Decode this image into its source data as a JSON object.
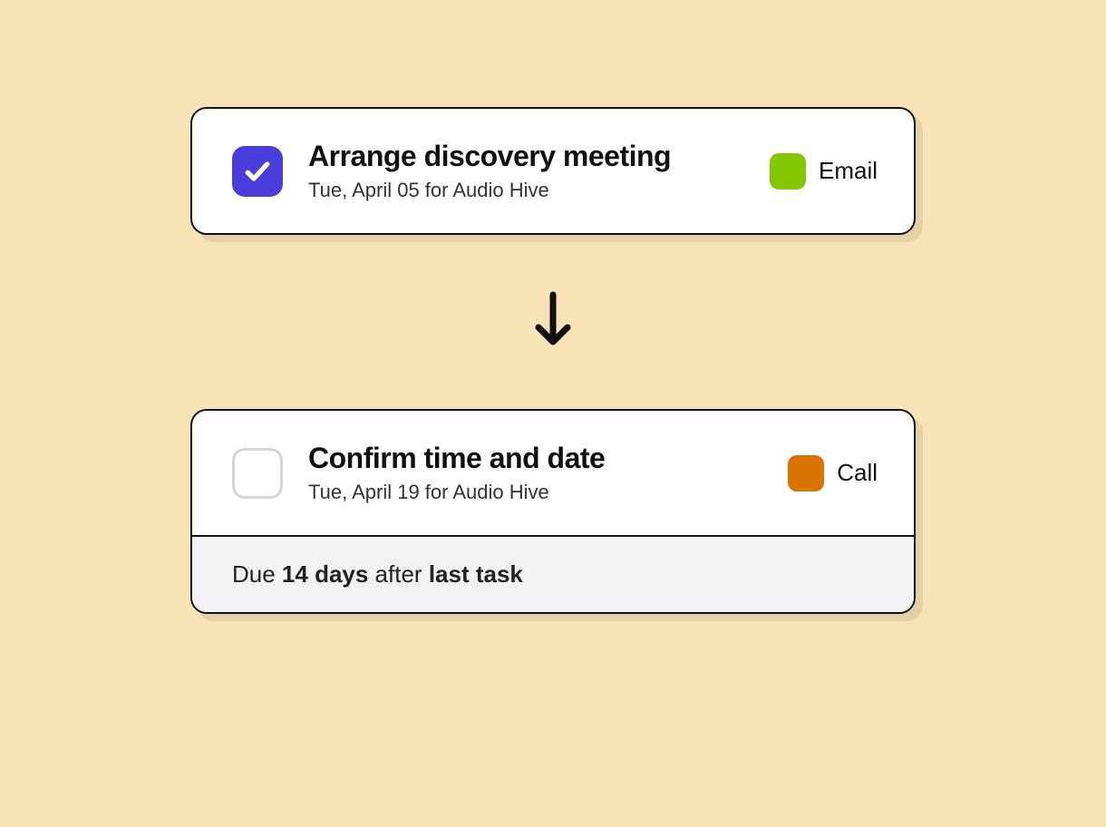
{
  "tasks": [
    {
      "title": "Arrange discovery meeting",
      "subtitle": "Tue, April 05 for Audio Hive",
      "checked": true,
      "tag": {
        "label": "Email",
        "color": "#84c700"
      }
    },
    {
      "title": "Confirm time and date",
      "subtitle": "Tue, April 19 for Audio Hive",
      "checked": false,
      "tag": {
        "label": "Call",
        "color": "#d97400"
      }
    }
  ],
  "due": {
    "prefix": "Due ",
    "duration": "14 days",
    "mid": " after ",
    "suffix": "last task"
  },
  "colors": {
    "canvas": "#f8e3b6",
    "checkbox_checked": "#4a3dd9",
    "tag_email": "#84c700",
    "tag_call": "#d97400"
  }
}
